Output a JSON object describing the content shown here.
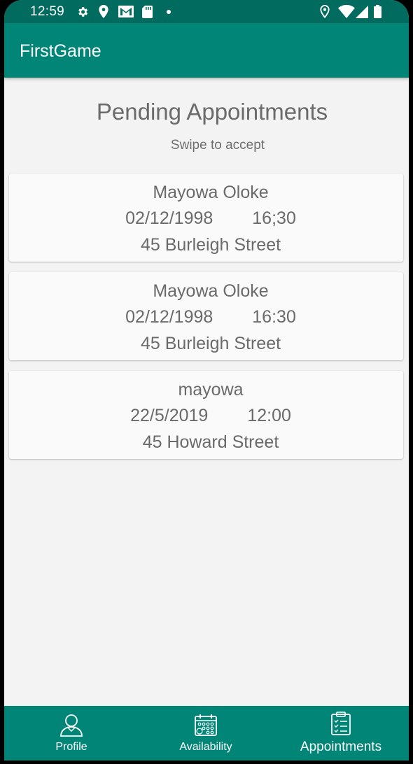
{
  "status_bar": {
    "time": "12:59"
  },
  "app_bar": {
    "title": "FirstGame"
  },
  "page": {
    "title": "Pending Appointments",
    "subtitle": "Swipe to accept"
  },
  "appointments": [
    {
      "name": "Mayowa Oloke",
      "date": "02/12/1998",
      "time": "16;30",
      "address": "45 Burleigh Street"
    },
    {
      "name": "Mayowa Oloke",
      "date": "02/12/1998",
      "time": "16:30",
      "address": "45 Burleigh Street"
    },
    {
      "name": "mayowa",
      "date": "22/5/2019",
      "time": "12:00",
      "address": "45 Howard Street"
    }
  ],
  "bottom_nav": {
    "items": [
      {
        "label": "Profile",
        "icon": "person-icon"
      },
      {
        "label": "Availability",
        "icon": "calendar-icon"
      },
      {
        "label": "Appointments",
        "icon": "clipboard-icon",
        "active": true
      }
    ]
  },
  "colors": {
    "primary": "#008577",
    "primary_dark": "#006b5e",
    "background": "#f3f3f3",
    "card": "#fafafa",
    "text": "#6a6a6a"
  }
}
